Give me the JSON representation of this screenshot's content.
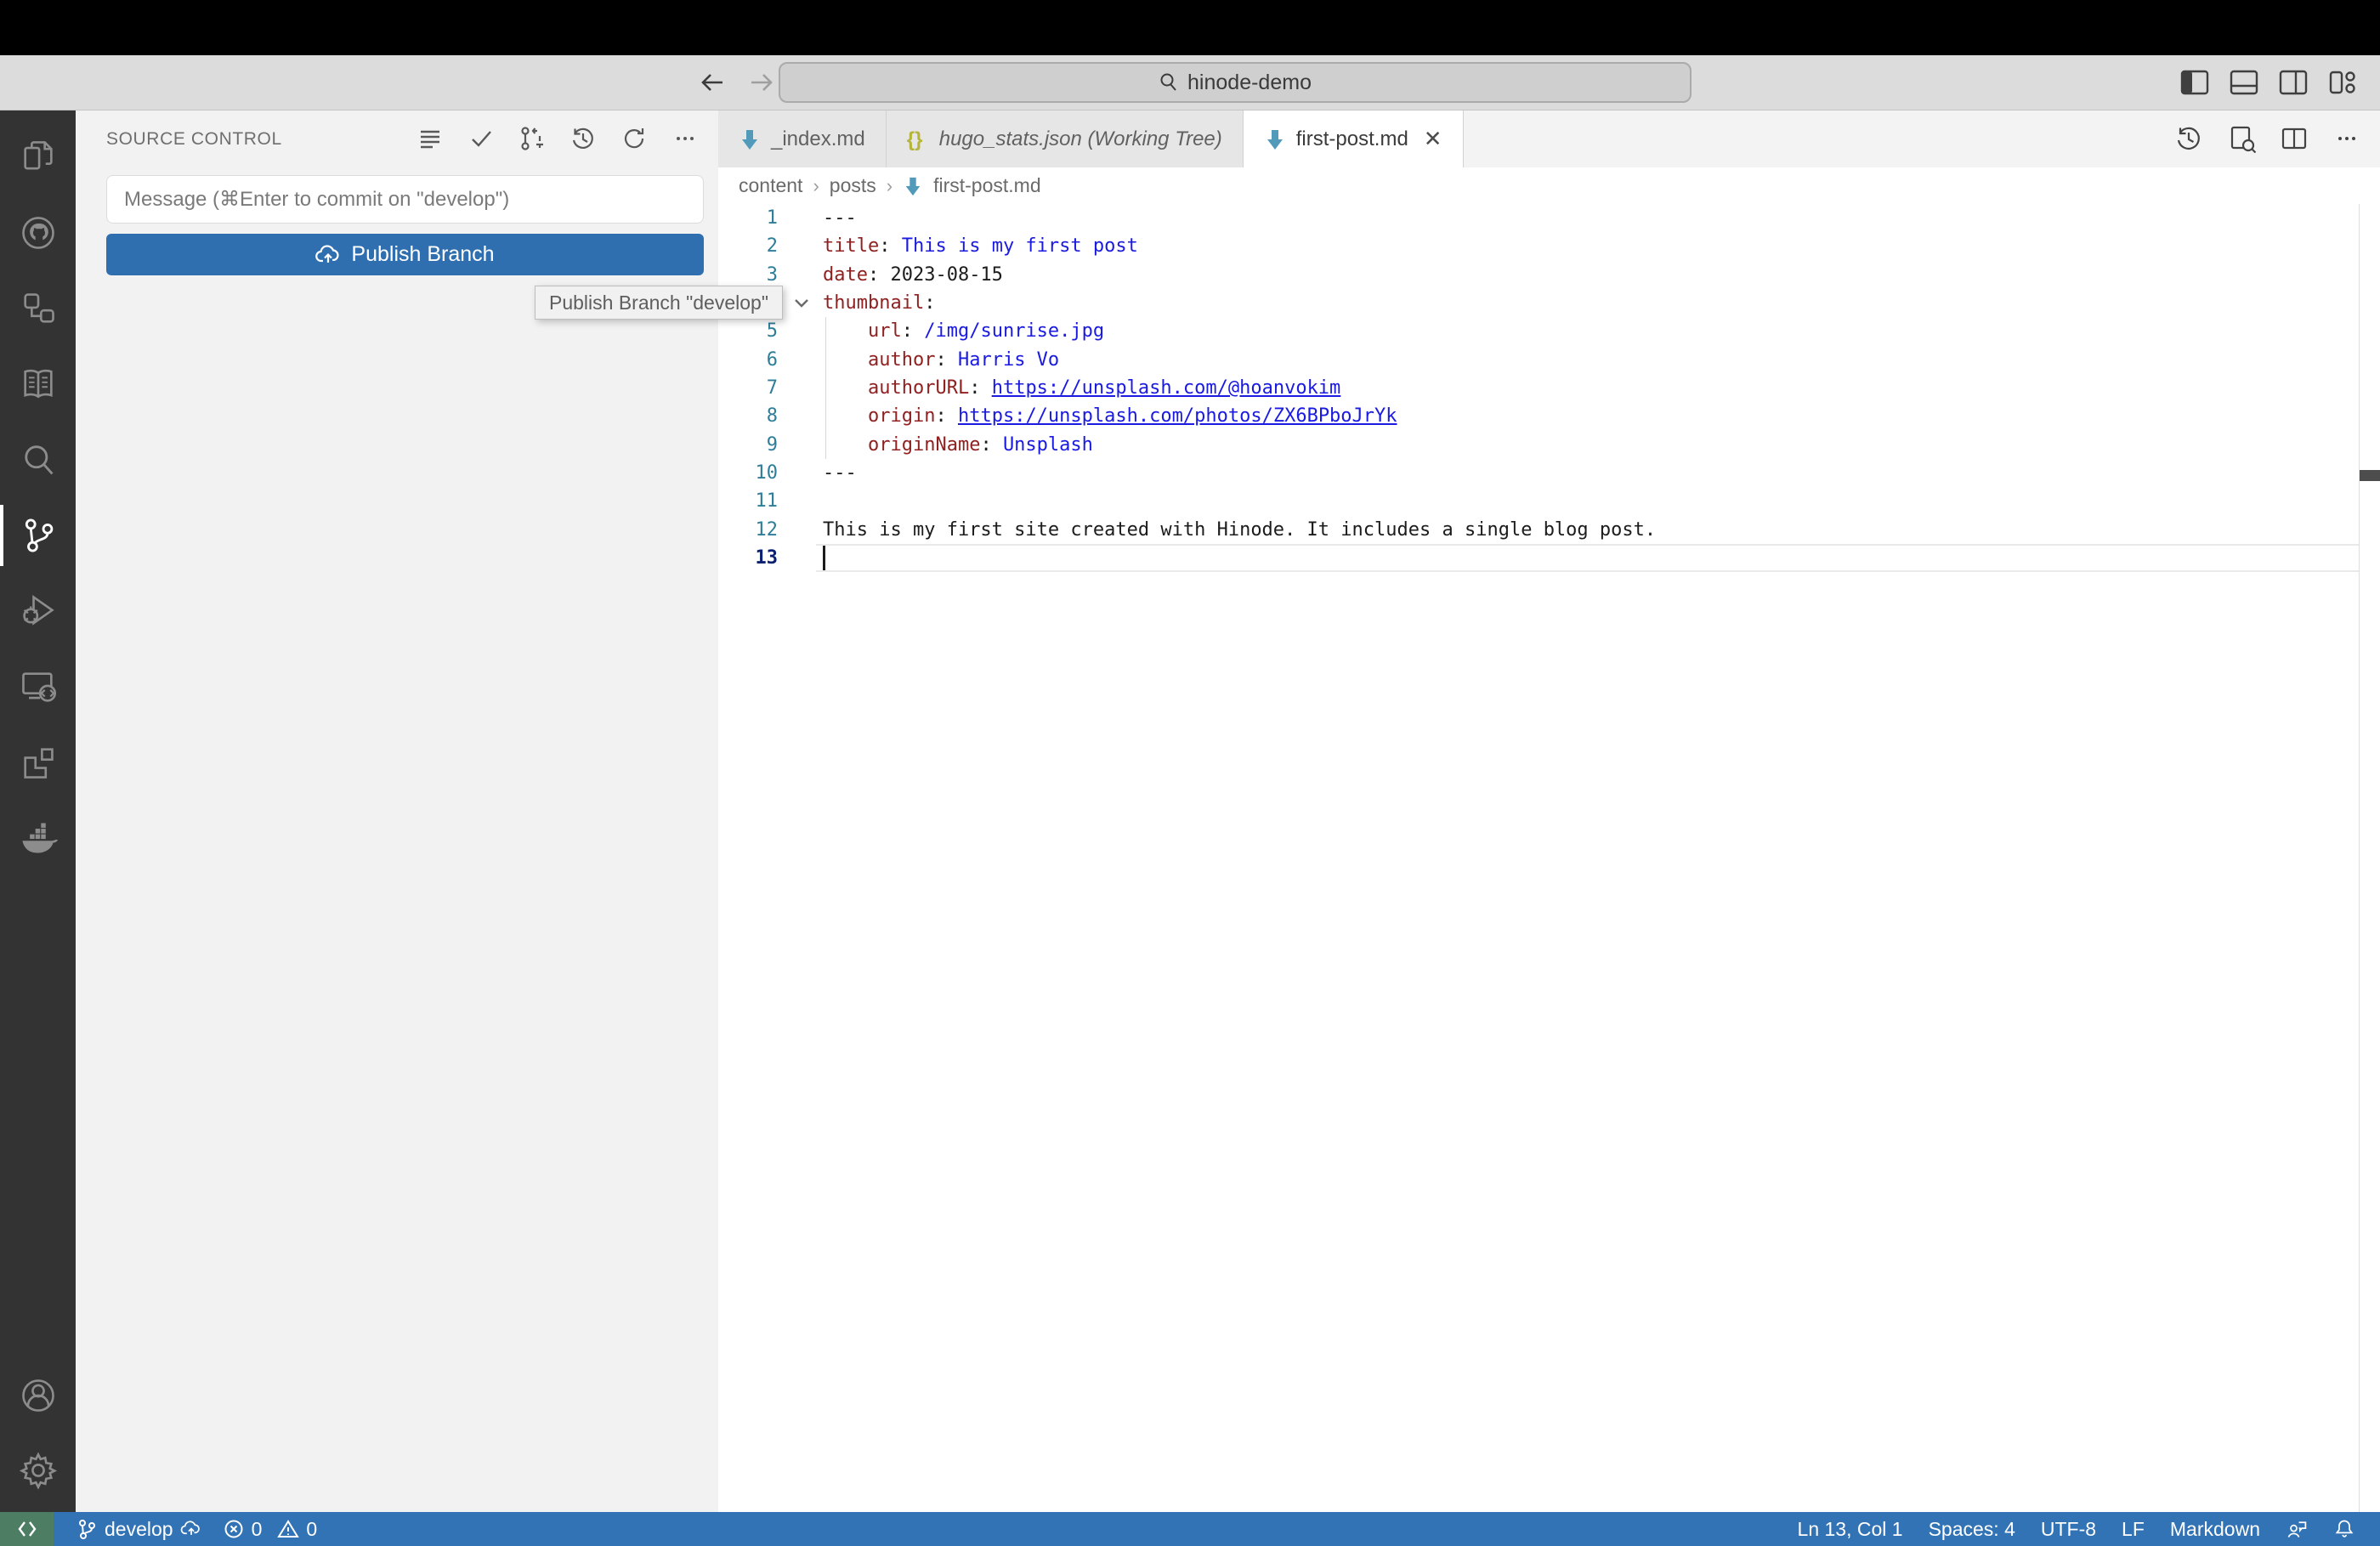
{
  "window": {
    "command_center_value": "hinode-demo"
  },
  "titlebar": {
    "icons": [
      "toggle-primary-sidebar",
      "toggle-panel",
      "toggle-secondary-sidebar",
      "customize-layout"
    ]
  },
  "activity_bar": {
    "items": [
      "explorer",
      "github",
      "references",
      "docs-book",
      "search",
      "source-control",
      "run-and-debug",
      "remote-explorer",
      "extensions",
      "docker"
    ],
    "active_item": "source-control",
    "bottom_items": [
      "accounts",
      "settings"
    ]
  },
  "source_control": {
    "title": "SOURCE CONTROL",
    "actions": [
      "view-as-list",
      "commit",
      "create-pull-request",
      "history",
      "refresh",
      "more-actions"
    ],
    "message_placeholder": "Message (⌘Enter to commit on \"develop\")",
    "publish_button_label": "Publish Branch",
    "tooltip": "Publish Branch \"develop\""
  },
  "tabs": [
    {
      "label": "_index.md",
      "icon": "markdown",
      "active": false
    },
    {
      "label": "hugo_stats.json (Working Tree)",
      "icon": "json",
      "active": false,
      "italic": true
    },
    {
      "label": "first-post.md",
      "icon": "markdown",
      "active": true,
      "close": "✕"
    }
  ],
  "editor_actions": [
    "timeline-history",
    "open-preview",
    "split-editor",
    "more-actions"
  ],
  "breadcrumb": {
    "items": [
      "content",
      "posts",
      "first-post.md"
    ],
    "separator": "›"
  },
  "editor": {
    "cursor_line": 13,
    "lines": [
      {
        "n": 1,
        "s": [
          {
            "c": "p",
            "t": "---"
          }
        ]
      },
      {
        "n": 2,
        "s": [
          {
            "c": "k",
            "t": "title"
          },
          {
            "c": "p",
            "t": ": "
          },
          {
            "c": "s",
            "t": "This is my first post"
          }
        ]
      },
      {
        "n": 3,
        "s": [
          {
            "c": "k",
            "t": "date"
          },
          {
            "c": "p",
            "t": ": 2023-08-15"
          }
        ]
      },
      {
        "n": 4,
        "s": [
          {
            "c": "k",
            "t": "thumbnail"
          },
          {
            "c": "p",
            "t": ":"
          }
        ],
        "fold": true
      },
      {
        "n": 5,
        "s": [
          {
            "c": "p",
            "t": "    "
          },
          {
            "c": "k",
            "t": "url"
          },
          {
            "c": "p",
            "t": ": "
          },
          {
            "c": "s",
            "t": "/img/sunrise.jpg"
          }
        ]
      },
      {
        "n": 6,
        "s": [
          {
            "c": "p",
            "t": "    "
          },
          {
            "c": "k",
            "t": "author"
          },
          {
            "c": "p",
            "t": ": "
          },
          {
            "c": "s",
            "t": "Harris Vo"
          }
        ]
      },
      {
        "n": 7,
        "s": [
          {
            "c": "p",
            "t": "    "
          },
          {
            "c": "k",
            "t": "authorURL"
          },
          {
            "c": "p",
            "t": ": "
          },
          {
            "c": "l",
            "t": "https://unsplash.com/@hoanvokim"
          }
        ]
      },
      {
        "n": 8,
        "s": [
          {
            "c": "p",
            "t": "    "
          },
          {
            "c": "k",
            "t": "origin"
          },
          {
            "c": "p",
            "t": ": "
          },
          {
            "c": "l",
            "t": "https://unsplash.com/photos/ZX6BPboJrYk"
          }
        ]
      },
      {
        "n": 9,
        "s": [
          {
            "c": "p",
            "t": "    "
          },
          {
            "c": "k",
            "t": "originName"
          },
          {
            "c": "p",
            "t": ": "
          },
          {
            "c": "s",
            "t": "Unsplash"
          }
        ]
      },
      {
        "n": 10,
        "s": [
          {
            "c": "p",
            "t": "---"
          }
        ]
      },
      {
        "n": 11,
        "s": []
      },
      {
        "n": 12,
        "s": [
          {
            "c": "p",
            "t": "This is my first site created with Hinode. It includes a single blog post."
          }
        ]
      },
      {
        "n": 13,
        "s": []
      }
    ]
  },
  "status_bar": {
    "branch": "develop",
    "errors": "0",
    "warnings": "0",
    "cursor_position": "Ln 13, Col 1",
    "indentation": "Spaces: 4",
    "encoding": "UTF-8",
    "eol": "LF",
    "language": "Markdown"
  },
  "colors": {
    "status_bar_blue": "#3273b5",
    "remote_indicator_green": "#4d7e63",
    "publish_button_blue": "#2f6fb0",
    "activity_bar_dark": "#333333",
    "yaml_key": "#8f2121",
    "yaml_value_blue": "#1a1ae0",
    "line_number": "#2e7d99"
  }
}
